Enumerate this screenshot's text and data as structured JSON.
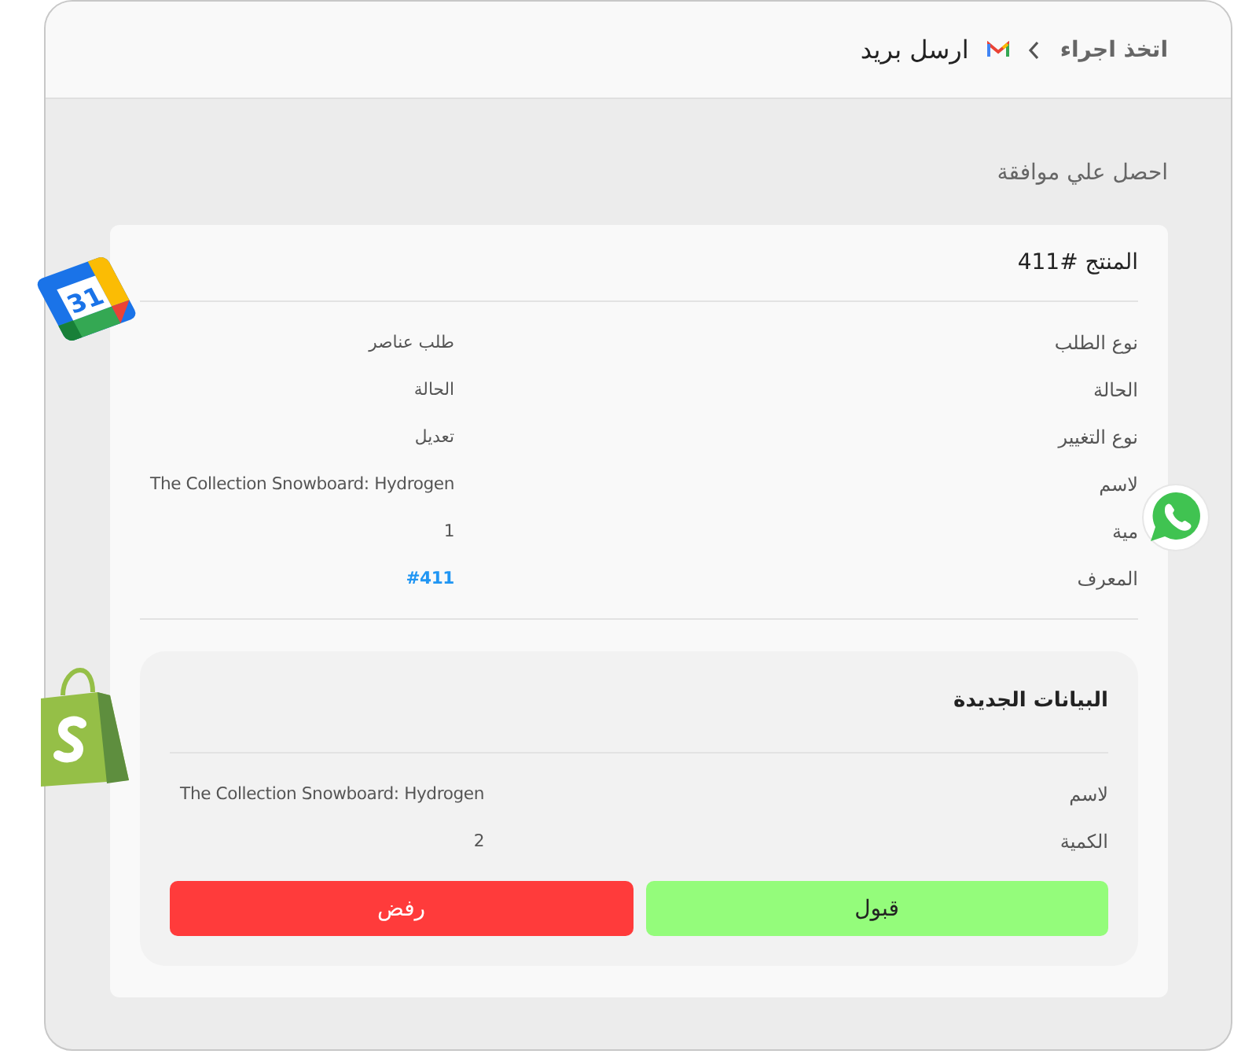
{
  "header": {
    "breadcrumb": [
      {
        "label": "اتخذ اجراء",
        "current": false
      },
      {
        "label": "ارسل بريد",
        "current": true
      }
    ]
  },
  "section_title": "احصل علي موافقة",
  "card": {
    "title": "المنتج #411",
    "rows": [
      {
        "label": "نوع الطلب",
        "value": "طلب عناصر",
        "kind": "text"
      },
      {
        "label": "الحالة",
        "value": "الحالة",
        "kind": "text"
      },
      {
        "label": "نوع التغيير",
        "value": "تعديل",
        "kind": "text"
      },
      {
        "label": "لاسم",
        "value": "The Collection Snowboard: Hydrogen",
        "kind": "text"
      },
      {
        "label": "مية",
        "value": "1",
        "kind": "text"
      },
      {
        "label": "المعرف",
        "value": "#411",
        "kind": "link"
      }
    ]
  },
  "new_data": {
    "title": "البيانات الجديدة",
    "rows": [
      {
        "label": "لاسم",
        "value": "The Collection Snowboard: Hydrogen"
      },
      {
        "label": "الكمية",
        "value": "2"
      }
    ],
    "buttons": [
      {
        "label": "قبول",
        "kind": "accept"
      },
      {
        "label": "رفض",
        "kind": "reject"
      }
    ]
  },
  "app_icons": [
    {
      "kind": "calendar",
      "text": "31"
    },
    {
      "kind": "shopify"
    },
    {
      "kind": "whatsapp"
    }
  ]
}
